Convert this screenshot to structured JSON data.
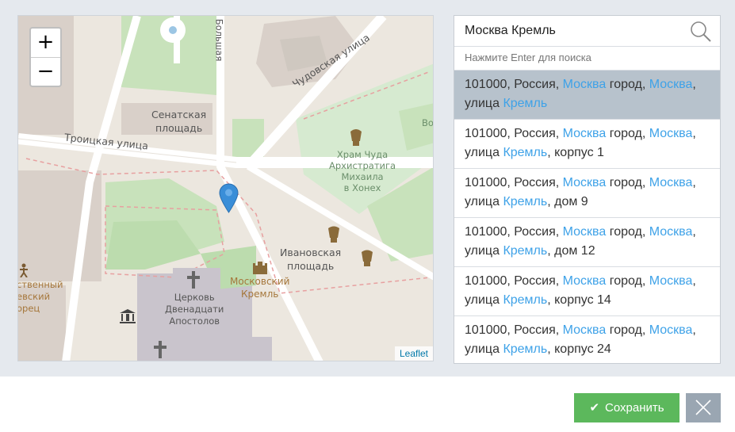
{
  "map": {
    "zoom_in_label": "+",
    "zoom_out_label": "−",
    "attribution": "Leaflet",
    "labels": {
      "senate_square": "Сенатская\nплощадь",
      "troitskaya": "Троицкая улица",
      "chudovskaya": "Чудовская улица",
      "bolshaya": "Большая",
      "temple": "Храм Чуда\nАрхистратига\nМихаила\nв Хонех",
      "ivanovskaya": "Ивановская\nплощадь",
      "moscow_kremlin": "Московский\nКремль",
      "church_twelve": "Церковь\nДвенадцати\nАпостолов",
      "palace_partial": "ственный\nевский\nорец",
      "partial_vo": "Во"
    }
  },
  "search": {
    "value": "Москва Кремль",
    "hint": "Нажмите Enter для поиска"
  },
  "results": [
    {
      "prefix": "101000, Россия, ",
      "city": "Москва",
      "mid1": " город, ",
      "city2": "Москва",
      "mid2": ",\nулица ",
      "street": "Кремль",
      "suffix": ""
    },
    {
      "prefix": "101000, Россия, ",
      "city": "Москва",
      "mid1": " город, ",
      "city2": "Москва",
      "mid2": ",\nулица ",
      "street": "Кремль",
      "suffix": ", корпус 1"
    },
    {
      "prefix": "101000, Россия, ",
      "city": "Москва",
      "mid1": " город, ",
      "city2": "Москва",
      "mid2": ",\nулица ",
      "street": "Кремль",
      "suffix": ", дом 9"
    },
    {
      "prefix": "101000, Россия, ",
      "city": "Москва",
      "mid1": " город, ",
      "city2": "Москва",
      "mid2": ",\nулица ",
      "street": "Кремль",
      "suffix": ", дом 12"
    },
    {
      "prefix": "101000, Россия, ",
      "city": "Москва",
      "mid1": " город, ",
      "city2": "Москва",
      "mid2": ",\nулица ",
      "street": "Кремль",
      "suffix": ", корпус 14"
    },
    {
      "prefix": "101000, Россия, ",
      "city": "Москва",
      "mid1": " город, ",
      "city2": "Москва",
      "mid2": ",\nулица ",
      "street": "Кремль",
      "suffix": ", корпус 24"
    }
  ],
  "footer": {
    "save_label": "Сохранить"
  },
  "colors": {
    "save": "#5cb85c",
    "close": "#9aa6b2",
    "highlight": "#3ea2e8",
    "selected_row": "#b7c2cc",
    "marker": "#3a8ed8"
  },
  "icons": {
    "search": "search-icon",
    "marker": "map-marker-icon",
    "check": "check-icon",
    "close": "close-icon"
  }
}
